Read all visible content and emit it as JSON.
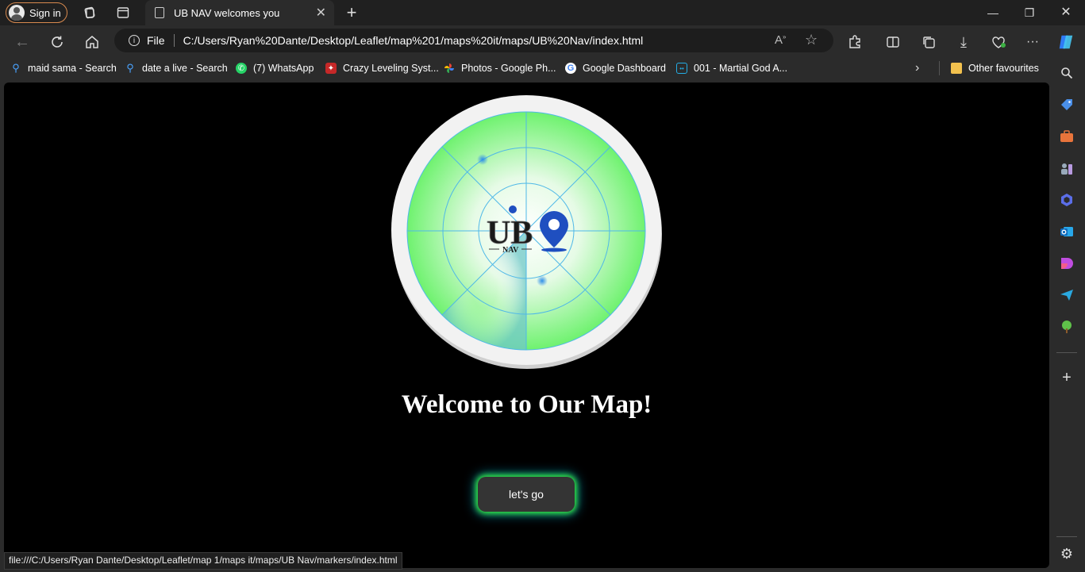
{
  "browser": {
    "signin_label": "Sign in",
    "tab_title": "UB NAV welcomes you",
    "address_scheme": "File",
    "address_url": "C:/Users/Ryan%20Dante/Desktop/Leaflet/map%201/maps%20it/maps/UB%20Nav/index.html",
    "status_url": "file:///C:/Users/Ryan Dante/Desktop/Leaflet/map 1/maps it/maps/UB Nav/markers/index.html"
  },
  "bookmarks": [
    {
      "label": "maid sama - Search",
      "icon": "search-icon"
    },
    {
      "label": "date a live - Search",
      "icon": "search-icon"
    },
    {
      "label": "(7) WhatsApp",
      "icon": "whatsapp-icon"
    },
    {
      "label": "Crazy Leveling Syst...",
      "icon": "site-icon"
    },
    {
      "label": "Photos - Google Ph...",
      "icon": "google-photos-icon"
    },
    {
      "label": "Google Dashboard",
      "icon": "google-icon"
    },
    {
      "label": "001 - Martial God A...",
      "icon": "bilibili-icon"
    },
    {
      "label": "Other favourites",
      "icon": "folder-icon"
    }
  ],
  "page": {
    "logo_text": "UB",
    "logo_subtext": "NAV",
    "heading": "Welcome to Our Map!",
    "button_label": "let's go"
  },
  "colors": {
    "radar_green": "#7df27d",
    "radar_line": "#4fb8e8",
    "button_glow": "#3cff3c",
    "logo_blue": "#1f4fc0"
  }
}
